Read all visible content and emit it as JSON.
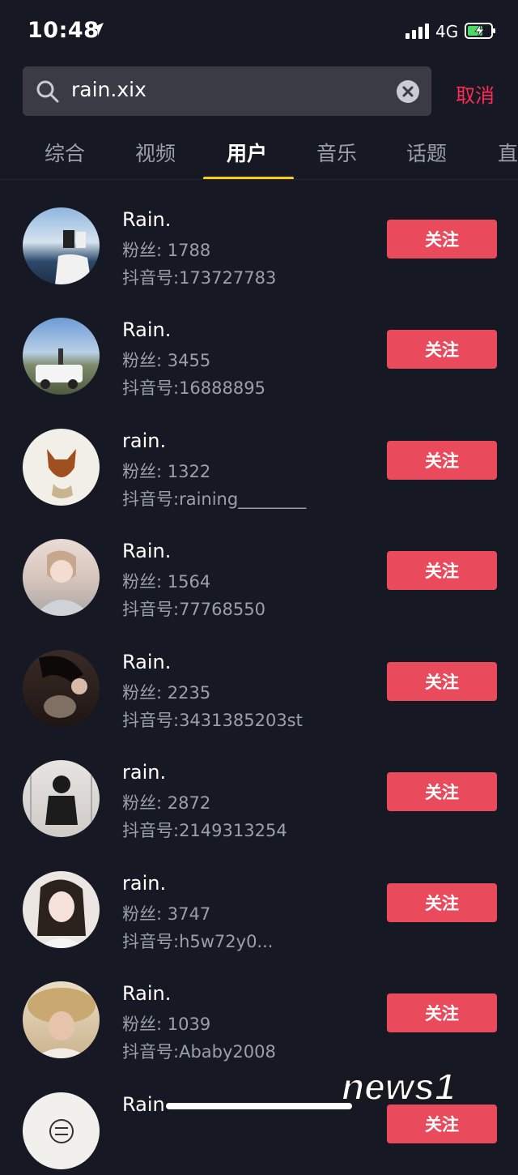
{
  "status_bar": {
    "time": "10:48",
    "network": "4G",
    "icons": [
      "location-arrow-icon",
      "signal-icon",
      "battery-charging-icon"
    ]
  },
  "search": {
    "query": "rain.xix",
    "cancel_label": "取消",
    "icons": [
      "search-icon",
      "clear-icon"
    ]
  },
  "tabs": [
    {
      "label": "综合"
    },
    {
      "label": "视频"
    },
    {
      "label": "用户",
      "active": true
    },
    {
      "label": "音乐"
    },
    {
      "label": "话题"
    },
    {
      "label": "直"
    }
  ],
  "users": [
    {
      "name": "Rain.",
      "fans": "粉丝: 1788",
      "id": "抖音号:173727783",
      "follow_label": "关注"
    },
    {
      "name": "Rain.",
      "fans": "粉丝: 3455",
      "id": "抖音号:16888895",
      "follow_label": "关注"
    },
    {
      "name": "rain.",
      "fans": "粉丝: 1322",
      "id": "抖音号:raining________",
      "follow_label": "关注"
    },
    {
      "name": "Rain.",
      "fans": "粉丝: 1564",
      "id": "抖音号:77768550",
      "follow_label": "关注"
    },
    {
      "name": "Rain.",
      "fans": "粉丝: 2235",
      "id": "抖音号:3431385203st",
      "follow_label": "关注"
    },
    {
      "name": "rain.",
      "fans": "粉丝: 2872",
      "id": "抖音号:2149313254",
      "follow_label": "关注"
    },
    {
      "name": "rain.",
      "fans": "粉丝: 3747",
      "id": "抖音号:h5w72y0...",
      "follow_label": "关注"
    },
    {
      "name": "Rain.",
      "fans": "粉丝: 1039",
      "id": "抖音号:Ababy2008",
      "follow_label": "关注"
    },
    {
      "name": "Rain",
      "fans": "",
      "id": "",
      "follow_label": "关注"
    }
  ],
  "watermark": {
    "text": "news1"
  },
  "colors": {
    "background": "#161823",
    "accent_red": "#ea4b5c",
    "cancel_red": "#fe2c55",
    "tab_underline": "#facc15",
    "muted_text": "#9aa0ab"
  }
}
